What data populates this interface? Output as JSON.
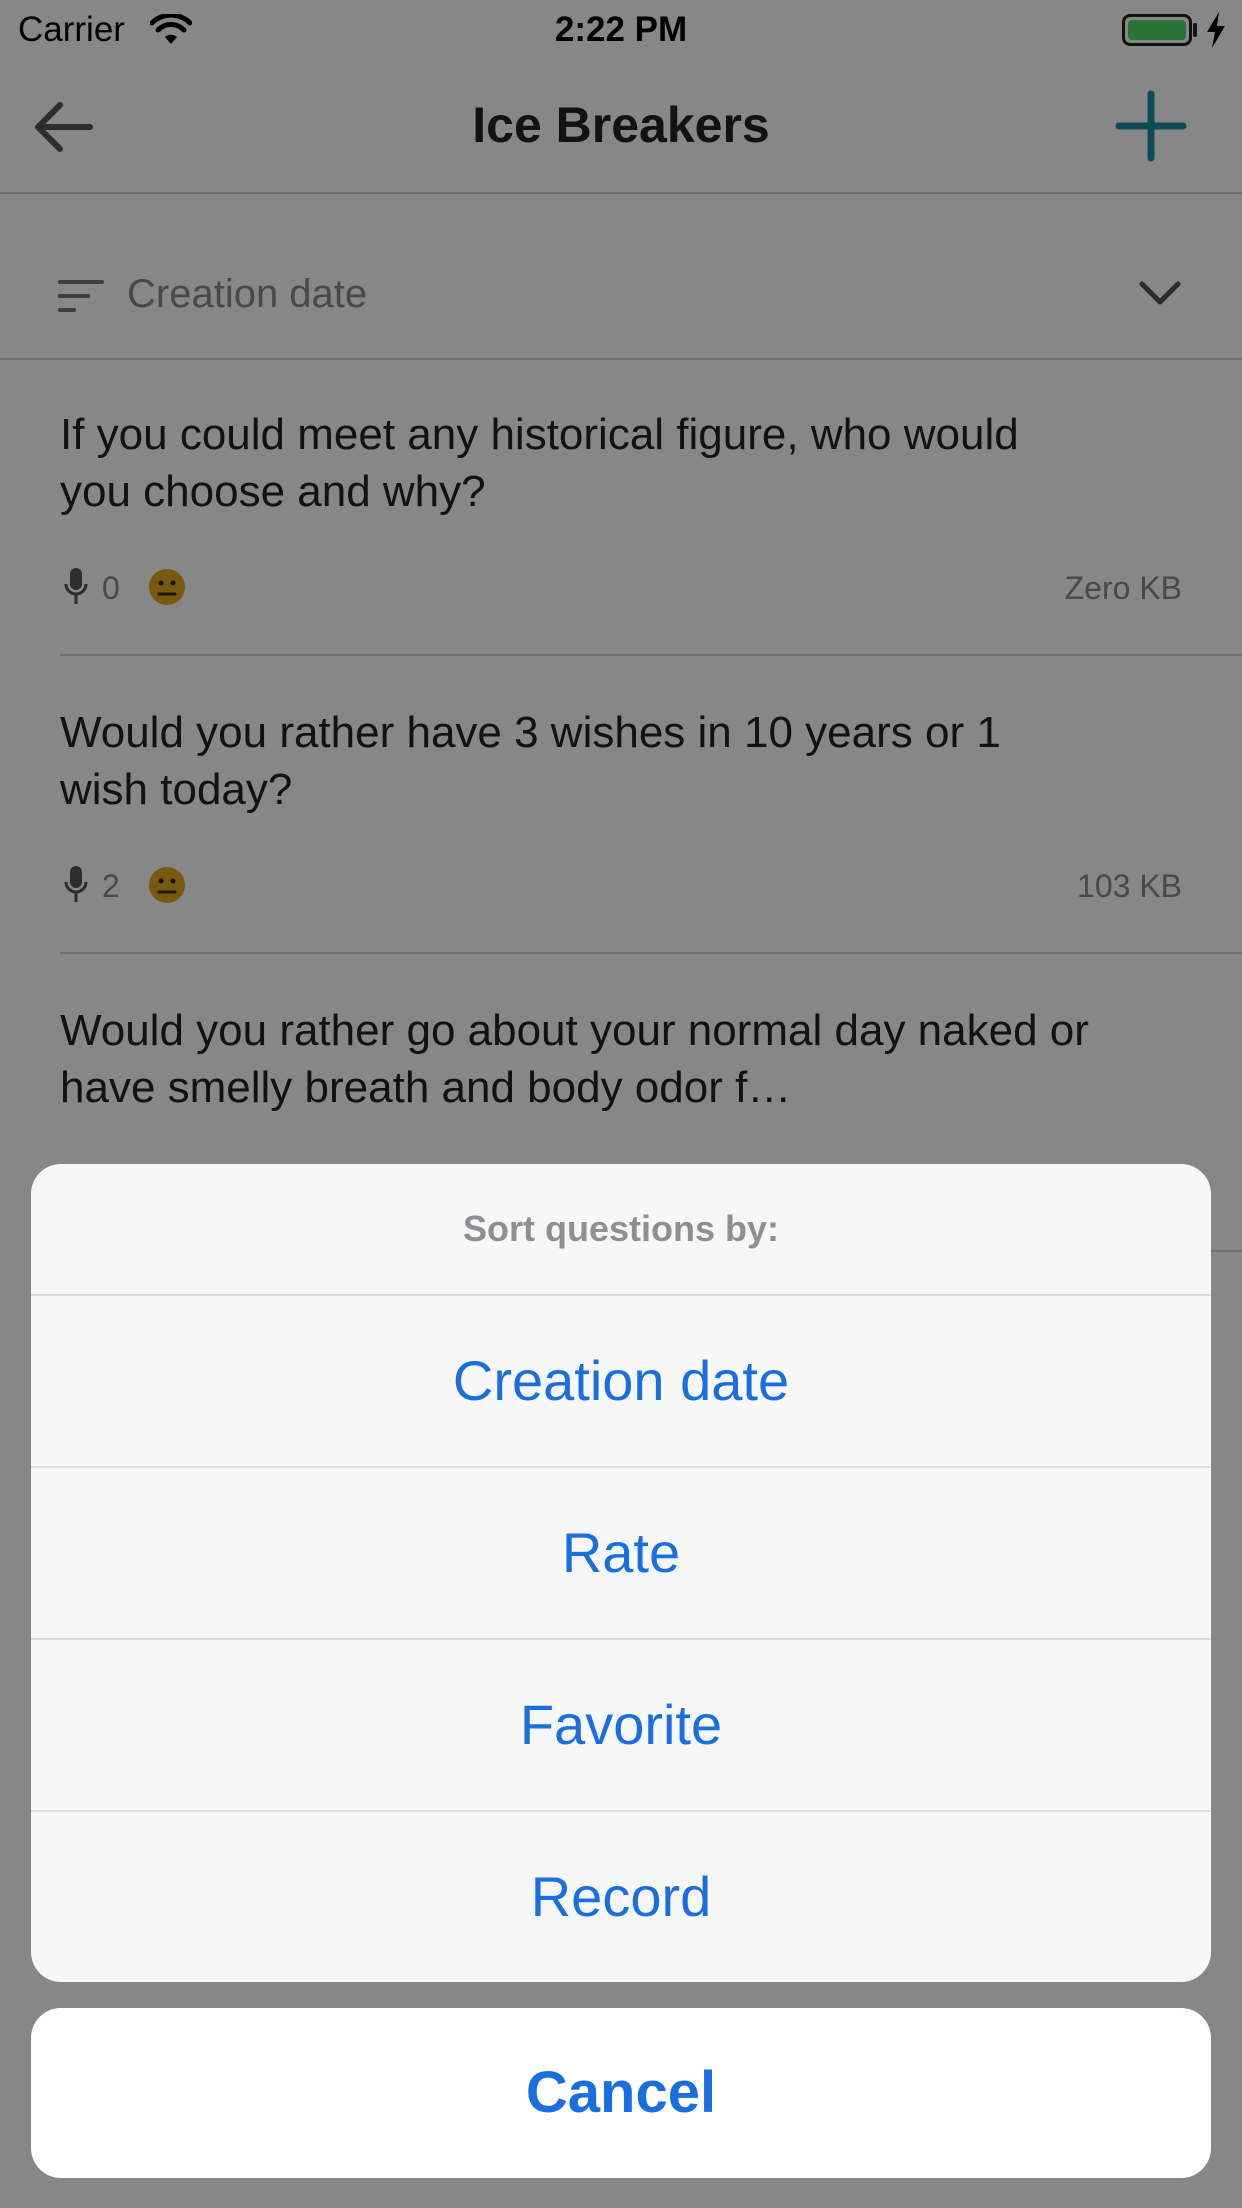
{
  "status_bar": {
    "carrier": "Carrier",
    "time": "2:22 PM"
  },
  "nav": {
    "title": "Ice Breakers"
  },
  "sort_bar": {
    "label": "Creation date"
  },
  "questions": [
    {
      "text": "If you could meet any historical figure, who would you choose and why?",
      "recordings": "0",
      "size": "Zero KB"
    },
    {
      "text": "Would you rather have 3 wishes in 10 years or 1 wish today?",
      "recordings": "2",
      "size": "103 KB"
    },
    {
      "text": "Would you rather go about your normal day naked or have smelly breath and body odor f…",
      "recordings": "",
      "size": ""
    }
  ],
  "action_sheet": {
    "title": "Sort questions by:",
    "options": [
      "Creation date",
      "Rate",
      "Favorite",
      "Record"
    ],
    "cancel": "Cancel"
  },
  "colors": {
    "accent": "#1a6fe0",
    "add_button": "#1b8ea0",
    "overlay": "rgba(0,0,0,0.47)",
    "battery": "#4cd964",
    "neutral_face": "#e0a81d"
  },
  "icons": [
    "wifi-icon",
    "battery-icon",
    "charging-bolt-icon",
    "back-arrow-icon",
    "plus-icon",
    "sort-lines-icon",
    "chevron-down-icon",
    "microphone-icon",
    "neutral-face-icon"
  ]
}
